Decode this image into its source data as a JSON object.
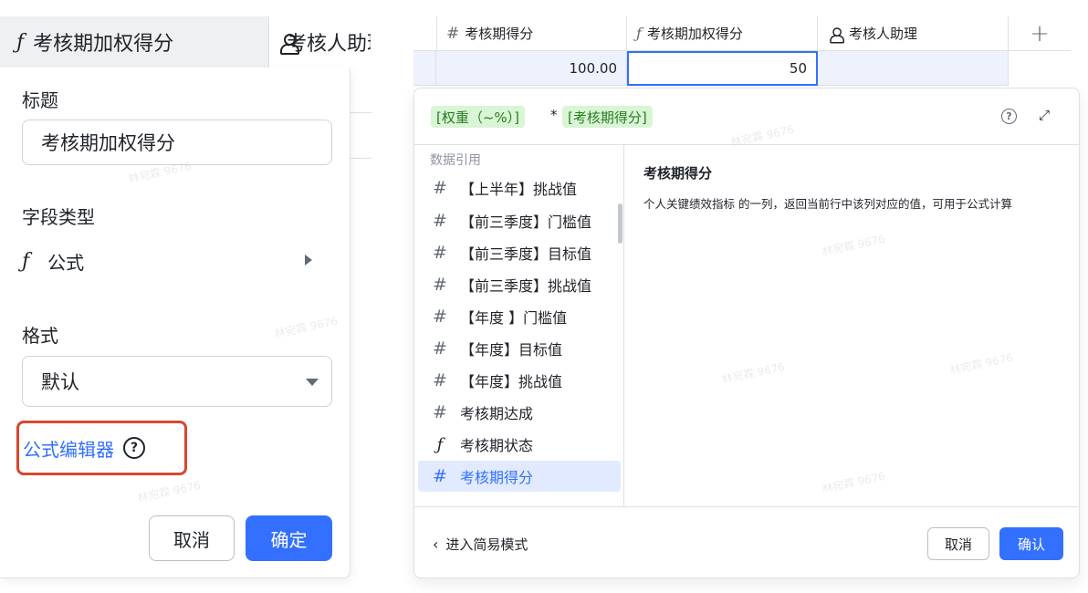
{
  "left_panel": {
    "column_header": "考核期加权得分",
    "next_column_header": "考核人助理",
    "title_label": "标题",
    "title_value": "考核期加权得分",
    "field_type_label": "字段类型",
    "field_type_value": "公式",
    "format_label": "格式",
    "format_value": "默认",
    "formula_editor_link": "公式编辑器",
    "help_glyph": "?",
    "cancel_label": "取消",
    "confirm_label": "确定"
  },
  "grid": {
    "headers": [
      "考核期得分",
      "考核期加权得分",
      "考核人助理"
    ],
    "add_column_glyph": "+",
    "row": [
      "100.00",
      "50",
      ""
    ]
  },
  "formula_dialog": {
    "token_1": "[权重（~%）]",
    "operator": "*",
    "token_2": "[考核期得分]",
    "help_glyph": "?",
    "expand_glyph": "⤢",
    "list_header": "数据引用",
    "fields": [
      {
        "icon": "number-icon",
        "label": "【上半年】挑战值"
      },
      {
        "icon": "number-icon",
        "label": "【前三季度】门槛值"
      },
      {
        "icon": "number-icon",
        "label": "【前三季度】目标值"
      },
      {
        "icon": "number-icon",
        "label": "【前三季度】挑战值"
      },
      {
        "icon": "number-icon",
        "label": "【年度 】门槛值"
      },
      {
        "icon": "number-icon",
        "label": "【年度】目标值"
      },
      {
        "icon": "number-icon",
        "label": "【年度】挑战值"
      },
      {
        "icon": "number-icon",
        "label": "考核期达成"
      },
      {
        "icon": "formula-icon",
        "label": "考核期状态"
      },
      {
        "icon": "number-icon",
        "label": "考核期得分",
        "selected": true
      }
    ],
    "desc_title": "考核期得分",
    "desc_text": "个人关键绩效指标 的一列，返回当前行中该列对应的值，可用于公式计算",
    "simple_mode_label": "进入简易模式",
    "cancel_label": "取消",
    "confirm_label": "确认"
  },
  "watermark": "林宛霖 9676",
  "colors": {
    "accent": "#3370ff",
    "highlight_border": "#d9462f",
    "token_bg": "#d9f5d6",
    "token_text": "#2a7c1f",
    "selected_row": "#e1eaff"
  }
}
